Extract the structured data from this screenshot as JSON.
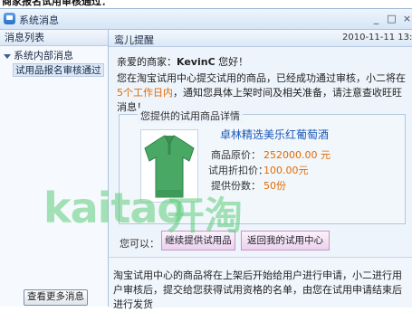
{
  "top_strip": "商家报名试用审核通过：",
  "window": {
    "title": "系统消息",
    "controls": {
      "minimize": "_",
      "maximize": "□",
      "close": "×"
    }
  },
  "left_pane": {
    "header": "消息列表",
    "group_label": "系统内部消息",
    "items": [
      {
        "label": "试用品报名审核通过"
      }
    ],
    "more_button": "查看更多消息"
  },
  "message": {
    "sender": "鸾儿提醒",
    "datetime": "2010-11-11  13:35",
    "greeting_prefix": "亲爱的商家：",
    "greeting_name": "KevinC",
    "greeting_suffix": " 您好！",
    "body_part1": "您在淘宝试用中心提交试用的商品，已经成功通过审核，小二将在",
    "body_highlight": "5个工作日内",
    "body_part2": "，通知您具体上架时间及相关准备，请注意查收旺旺消息！"
  },
  "product_panel": {
    "legend": "您提供的试用商品详情",
    "product_name": "卓林精选美乐红葡萄酒",
    "rows": [
      {
        "label": "商品原价：",
        "value": "252000.00 元"
      },
      {
        "label": "试用折扣价：",
        "value": "100.00元"
      },
      {
        "label": "提供份数：",
        "value": "50份"
      }
    ]
  },
  "actions": {
    "label": "您可以：",
    "continue_button": "继续提供试用品",
    "return_button": "返回我的试用中心"
  },
  "footer": {
    "text": "淘宝试用中心的商品将在上架后开始给用户进行申请，小二进行用户审核后，提交给您获得试用资格的名单，由您在试用申请结束后进行发货"
  },
  "watermark": {
    "latin": "kaitao",
    "cn": "开淘"
  },
  "colors": {
    "accent_orange": "#e26a00",
    "link_blue": "#1857b5",
    "watermark_green": "#5fcc7b",
    "shirt_green": "#4aa865"
  }
}
